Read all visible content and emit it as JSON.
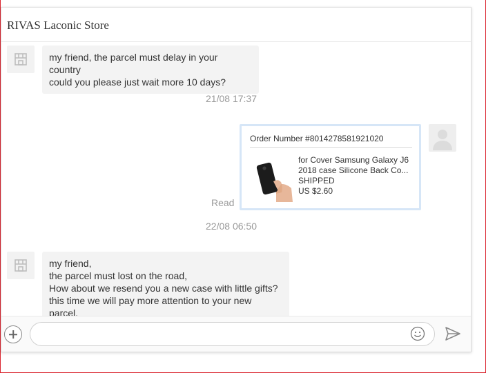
{
  "header": {
    "store_name": "RIVAS Laconic Store"
  },
  "messages": {
    "m1": {
      "line1": "my friend, the parcel must delay in your country",
      "line2": "could you please just wait more 10 days?"
    },
    "ts1": "21/08 17:37",
    "order": {
      "number_label": "Order Number #8014278581921020",
      "title_line1": "for Cover Samsung Galaxy J6",
      "title_line2": "2018 case Silicone Back Co...",
      "status": "SHIPPED",
      "price": "US $2.60"
    },
    "read_status": "Read",
    "ts2": "22/08 06:50",
    "m2": {
      "line1": "my friend,",
      "line2": "the parcel must lost on the road,",
      "line3": "How about we resend you a new case with little gifts?",
      "line4": "this time we will pay more attention to your new parcel."
    }
  },
  "composer": {
    "placeholder": ""
  },
  "icons": {
    "store_avatar": "store-icon",
    "user_avatar": "user-avatar-icon",
    "plus": "plus-icon",
    "emoji": "smiley-icon",
    "send": "send-icon"
  },
  "colors": {
    "frame_border": "#d9232d",
    "card_border": "#d6e6f7",
    "bubble_bg": "#f3f3f3"
  }
}
